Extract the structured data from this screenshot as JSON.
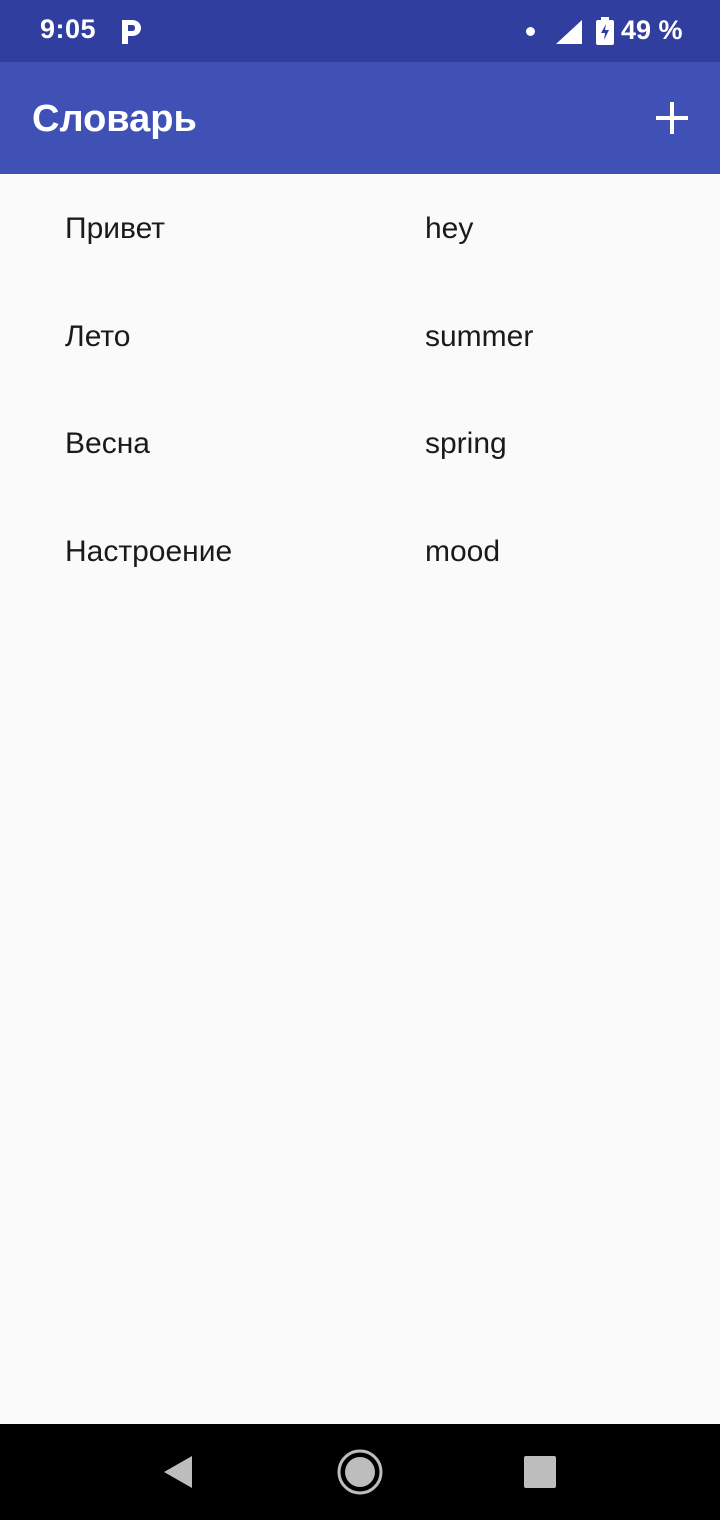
{
  "status_bar": {
    "time": "9:05",
    "notification_icon": "p-icon",
    "battery_percent": "49 %",
    "icons": [
      "notification-dot-icon",
      "signal-icon",
      "battery-charging-icon"
    ]
  },
  "app_bar": {
    "title": "Словарь",
    "action_icon": "add-icon"
  },
  "words": [
    {
      "ru": "Привет",
      "en": "hey"
    },
    {
      "ru": "Лето",
      "en": "summer"
    },
    {
      "ru": "Весна",
      "en": "spring"
    },
    {
      "ru": "Настроение",
      "en": "mood"
    }
  ],
  "nav_bar": {
    "icons": [
      "back-icon",
      "home-icon",
      "recents-icon"
    ]
  },
  "colors": {
    "status_bar": "#303f9f",
    "app_bar": "#3f51b5",
    "background": "#fafafa",
    "nav_bar": "#000000"
  }
}
